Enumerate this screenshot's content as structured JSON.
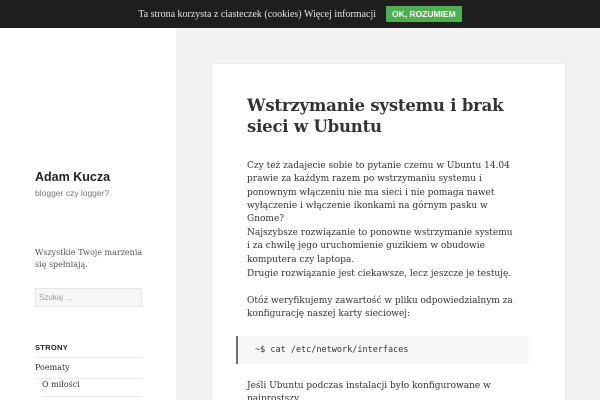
{
  "cookie_bar": {
    "text": "Ta strona korzysta z ciasteczek (cookies) Więcej informacji",
    "button": "OK, ROZUMIEM"
  },
  "sidebar": {
    "site_title": "Adam Kucza",
    "site_description": "blogger czy logger?",
    "text_widget": "Wszystkie Twoje marzenia się spełniają.",
    "search_placeholder": "Szukaj …",
    "pages_title": "STRONY",
    "menu": [
      {
        "label": "Poematy"
      },
      {
        "label": "O miłości"
      }
    ]
  },
  "post": {
    "title": "Wstrzymanie systemu i brak sieci w Ubuntu",
    "paragraphs": [
      "Czy też zadajecie sobie to pytanie czemu w Ubuntu 14.04 prawie za każdym razem po wstrzymaniu systemu i ponownym włączeniu nie ma sieci i nie pomaga nawet wyłączenie i włączenie ikonkami na górnym pasku w Gnome?",
      "Najszybsze rozwiązanie to ponowne wstrzymanie systemu i za chwilę jego uruchomienie guzikiem w obudowie komputera czy laptopa.",
      "Drugie rozwiązanie jest ciekawsze, lecz jeszcze je testuję.",
      "Otóż weryfikujemy zawartość w pliku odpowiedzialnym za konfigurację naszej karty sieciowej:",
      "Jeśli Ubuntu podczas instalacji było konfigurowane w najprostszy"
    ],
    "code": "~$ cat /etc/network/interfaces"
  }
}
